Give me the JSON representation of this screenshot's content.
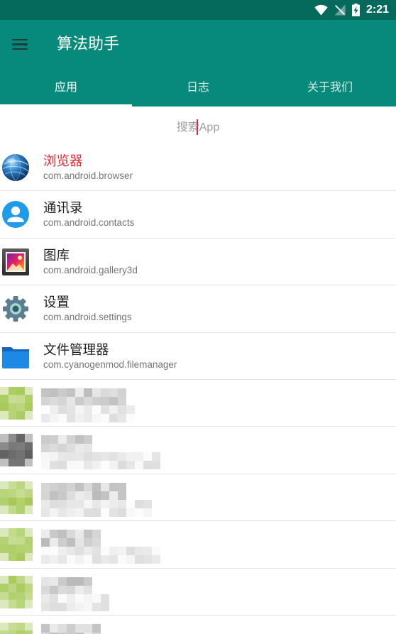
{
  "status_bar": {
    "time": "2:21",
    "icons": [
      "wifi-icon",
      "no-signal-icon",
      "battery-charging-icon"
    ]
  },
  "app_bar": {
    "title": "算法助手",
    "menu_icon": "menu-icon"
  },
  "tabs": [
    {
      "label": "应用",
      "selected": true
    },
    {
      "label": "日志",
      "selected": false
    },
    {
      "label": "关于我们",
      "selected": false
    }
  ],
  "search": {
    "placeholder": "搜索App"
  },
  "apps": [
    {
      "name": "浏览器",
      "package": "com.android.browser",
      "icon": "browser-icon",
      "highlighted": true
    },
    {
      "name": "通讯录",
      "package": "com.android.contacts",
      "icon": "contacts-icon",
      "highlighted": false
    },
    {
      "name": "图库",
      "package": "com.android.gallery3d",
      "icon": "gallery-icon",
      "highlighted": false
    },
    {
      "name": "设置",
      "package": "com.android.settings",
      "icon": "settings-icon",
      "highlighted": false
    },
    {
      "name": "文件管理器",
      "package": "com.cyanogenmod.filemanager",
      "icon": "folder-icon",
      "highlighted": false
    }
  ],
  "redacted_apps": [
    {
      "icon_color": "#a6c957"
    },
    {
      "icon_color": "#5e5e5e"
    },
    {
      "icon_color": "#a6c957"
    },
    {
      "icon_color": "#a6c957"
    },
    {
      "icon_color": "#a6c957"
    },
    {
      "icon_color": "#a6c957"
    }
  ],
  "colors": {
    "status_bar": "#05695c",
    "app_bar": "#078a7b",
    "menu_icon": "#1d3c37",
    "cursor": "#e2285a",
    "highlight_title": "#e8262d",
    "title": "#212121",
    "subtitle": "#757575",
    "hint": "#9e9e9e",
    "divider": "#e2e2e2",
    "redacted_title": "#a9a9a9",
    "redacted_subtitle": "#cdcdcd"
  }
}
